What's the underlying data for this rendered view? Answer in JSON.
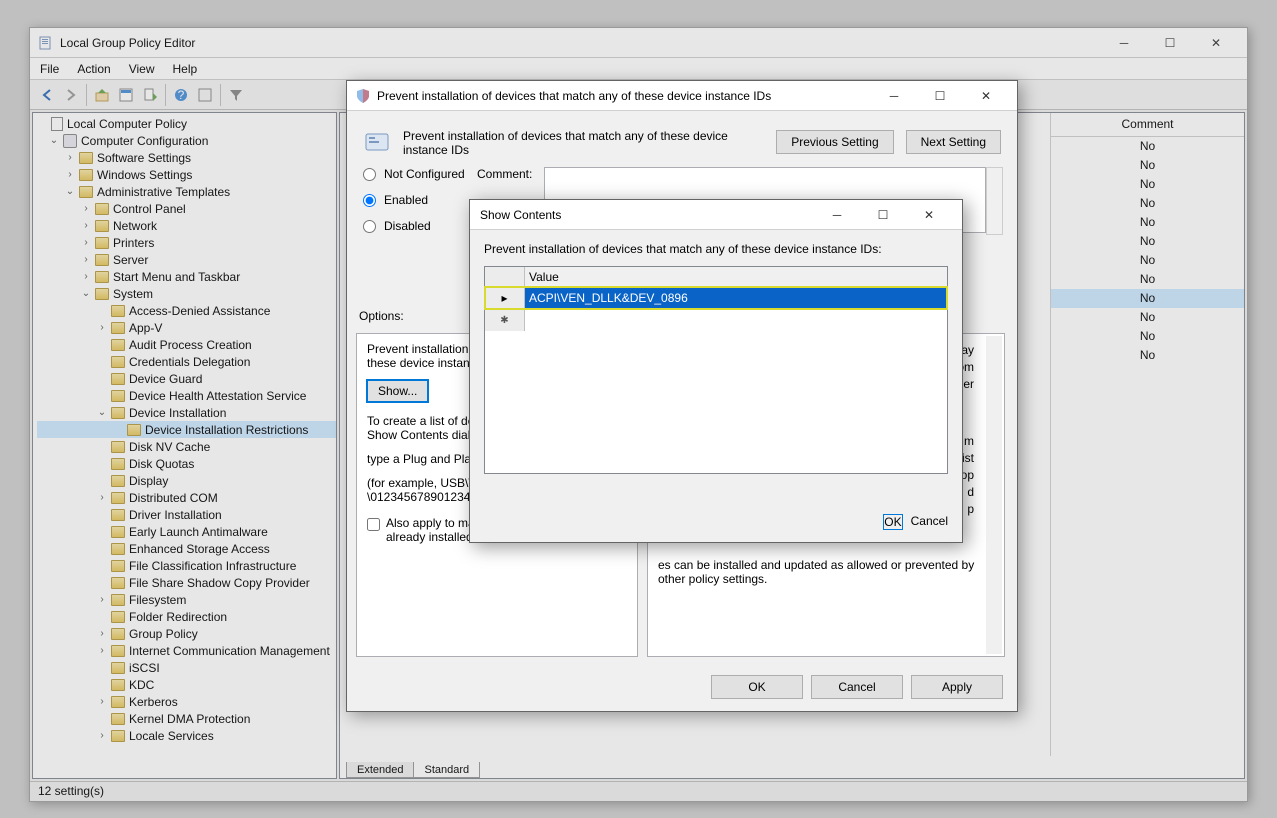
{
  "main": {
    "title": "Local Group Policy Editor",
    "menus": [
      "File",
      "Action",
      "View",
      "Help"
    ],
    "status": "12 setting(s)",
    "tabs": [
      "Extended",
      "Standard"
    ],
    "active_tab": 1,
    "comment_header": "Comment",
    "comment_values": [
      "No",
      "No",
      "No",
      "No",
      "No",
      "No",
      "No",
      "No",
      "No",
      "No",
      "No",
      "No"
    ]
  },
  "tree": {
    "root": "Local Computer Policy",
    "computer_config": "Computer Configuration",
    "software": "Software Settings",
    "windows": "Windows Settings",
    "admin": "Administrative Templates",
    "admin_children": [
      "Control Panel",
      "Network",
      "Printers",
      "Server",
      "Start Menu and Taskbar"
    ],
    "system": "System",
    "system_children": [
      "Access-Denied Assistance",
      "App-V",
      "Audit Process Creation",
      "Credentials Delegation",
      "Device Guard",
      "Device Health Attestation Service",
      "Device Installation"
    ],
    "dev_install_child": "Device Installation Restrictions",
    "system_after": [
      "Disk NV Cache",
      "Disk Quotas",
      "Display",
      "Distributed COM",
      "Driver Installation",
      "Early Launch Antimalware",
      "Enhanced Storage Access",
      "File Classification Infrastructure",
      "File Share Shadow Copy Provider",
      "Filesystem",
      "Folder Redirection",
      "Group Policy",
      "Internet Communication Management",
      "iSCSI",
      "KDC",
      "Kerberos",
      "Kernel DMA Protection",
      "Locale Services"
    ]
  },
  "policy": {
    "title": "Prevent installation of devices that match any of these device instance IDs",
    "heading": "Prevent installation of devices that match any of these device instance IDs",
    "prev": "Previous Setting",
    "next": "Next Setting",
    "nc": "Not Configured",
    "en": "Enabled",
    "dis": "Disabled",
    "comment_lbl": "Comment:",
    "options_lbl": "Options:",
    "opt_line1": "Prevent installation of devices that match any of these device instance IDs:",
    "show": "Show...",
    "opt_p1": "To create a list of devices, click Show. In the Show Contents dialog box, in the Value column,",
    "opt_p2": "type a Plug and Play device instance ID",
    "opt_p3": "(for example, USB\\VID_045E&PID_0123 \\01234567890123456789).",
    "chk": "Also apply to matching devices that are already installed.",
    "help_frag1": "Play",
    "help_frag2": "from",
    "help_frag3": "her",
    "help_frag4": "m",
    "help_frag5": "list",
    "help_frag6": "esktop",
    "help_frag7": "d",
    "help_frag8": "p",
    "help_p": "es can be installed and updated as allowed or prevented by other policy settings.",
    "ok": "OK",
    "cancel": "Cancel",
    "apply": "Apply"
  },
  "show": {
    "title": "Show Contents",
    "prompt": "Prevent installation of devices that match any of these device instance IDs:",
    "col": "Value",
    "value": "ACPI\\VEN_DLLK&DEV_0896",
    "ok": "OK",
    "cancel": "Cancel"
  }
}
